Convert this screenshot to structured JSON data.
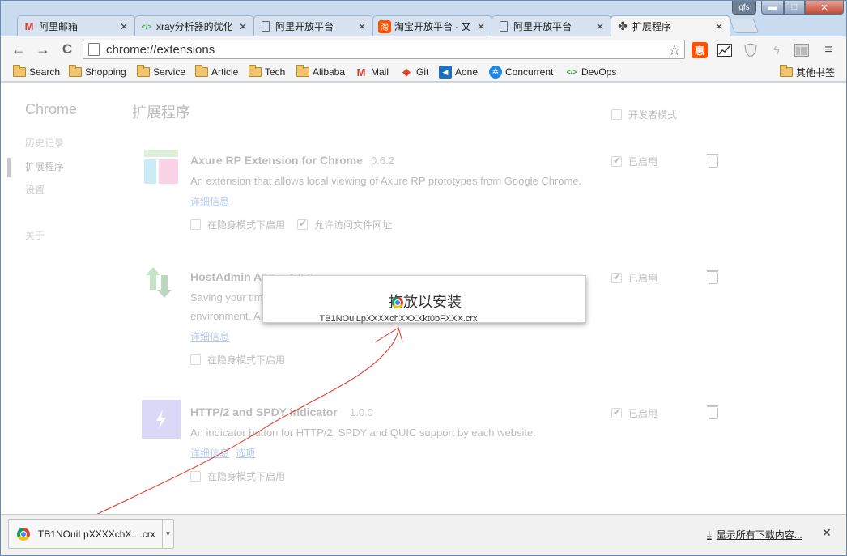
{
  "window": {
    "profile": "gfs",
    "min": "▬",
    "max": "□",
    "close": "✕"
  },
  "tabs": [
    {
      "title": "阿里邮箱",
      "icon": "M",
      "icon_color": "#d23f31"
    },
    {
      "title": "xray分析器的优化",
      "icon": "</>",
      "icon_color": "#3ca650"
    },
    {
      "title": "阿里开放平台",
      "icon": "page",
      "icon_color": "#555555"
    },
    {
      "title": "淘宝开放平台 - 文",
      "icon": "淘",
      "icon_color": "#ff5000"
    },
    {
      "title": "阿里开放平台",
      "icon": "page",
      "icon_color": "#555555"
    },
    {
      "title": "扩展程序",
      "icon": "puzzle",
      "icon_color": "#444444",
      "active": true
    }
  ],
  "toolbar": {
    "url": "chrome://extensions",
    "back": "←",
    "forward": "→",
    "reload": "C",
    "star": "☆"
  },
  "bookmarks": [
    {
      "label": "Search",
      "type": "folder"
    },
    {
      "label": "Shopping",
      "type": "folder"
    },
    {
      "label": "Service",
      "type": "folder"
    },
    {
      "label": "Article",
      "type": "folder"
    },
    {
      "label": "Tech",
      "type": "folder"
    },
    {
      "label": "Alibaba",
      "type": "folder"
    },
    {
      "label": "Mail",
      "type": "icon",
      "icon": "M",
      "color": "#d23f31"
    },
    {
      "label": "Git",
      "type": "icon",
      "icon": "◆",
      "color": "#e2432a"
    },
    {
      "label": "Aone",
      "type": "icon",
      "icon": "◀",
      "color": "#1f6fbf"
    },
    {
      "label": "Concurrent",
      "type": "icon",
      "icon": "✲",
      "color": "#1e88e5"
    },
    {
      "label": "DevOps",
      "type": "icon",
      "icon": "</>",
      "color": "#3ca650"
    }
  ],
  "other_bookmarks": "其他书签",
  "sidebar": {
    "title": "Chrome",
    "items": [
      "历史记录",
      "扩展程序",
      "设置",
      "关于"
    ]
  },
  "main": {
    "title": "扩展程序",
    "devmode": "开发者模式"
  },
  "extensions": [
    {
      "name": "Axure RP Extension for Chrome",
      "version": "0.6.2",
      "desc": "An extension that allows local viewing of Axure RP prototypes from Google Chrome.",
      "desc2": "",
      "links": [
        "详细信息"
      ],
      "opts": [
        "在隐身模式下启用",
        "允许访问文件网址"
      ],
      "enabled": "已启用"
    },
    {
      "name": "HostAdmin App",
      "version": "1.2.6",
      "desc": "Saving your time",
      "desc2": "environment. A",
      "links": [
        "详细信息"
      ],
      "opts": [
        "在隐身模式下启用"
      ],
      "enabled": "已启用"
    },
    {
      "name": "HTTP/2 and SPDY indicator",
      "version": "1.0.0",
      "desc": "An indicator button for HTTP/2, SPDY and QUIC support by each website.",
      "desc2": "",
      "links": [
        "详细信息",
        "选项"
      ],
      "opts": [
        "在隐身模式下启用"
      ],
      "enabled": "已启用"
    }
  ],
  "drop_dialog": {
    "title": "拖放以安装",
    "file": "TB1NOuiLpXXXXchXXXXkt0bFXXX.crx"
  },
  "download_shelf": {
    "file": "TB1NOuiLpXXXXchX....crx",
    "menu": "▼",
    "show_all": "显示所有下载内容...",
    "close": "✕"
  }
}
